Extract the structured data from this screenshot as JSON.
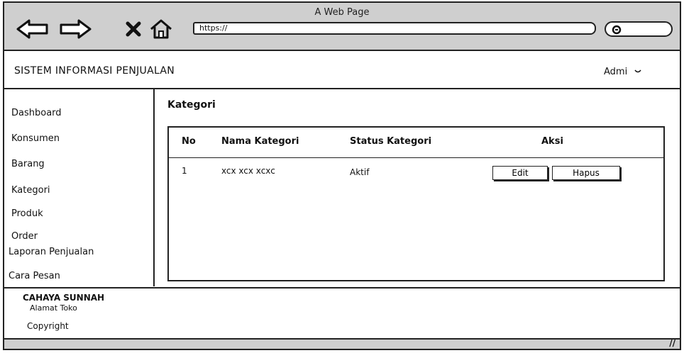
{
  "browser": {
    "window_title": "A Web Page",
    "url": "https://",
    "icons": [
      "back-arrow-icon",
      "forward-arrow-icon",
      "close-x-icon",
      "home-icon",
      "search-icon"
    ]
  },
  "header": {
    "app_title": "SISTEM INFORMASI PENJUALAN",
    "user_label": "Admi",
    "user_icon": "chevron-down-icon"
  },
  "sidebar": {
    "items": [
      {
        "label": "Dashboard"
      },
      {
        "label": "Konsumen"
      },
      {
        "label": "Barang"
      },
      {
        "label": "Kategori"
      },
      {
        "label": "Produk"
      },
      {
        "label": "Order"
      },
      {
        "label": "Laporan Penjualan"
      },
      {
        "label": "Cara Pesan"
      }
    ]
  },
  "main": {
    "page_title": "Kategori",
    "table": {
      "headers": [
        "No",
        "Nama Kategori",
        "Status Kategori",
        "Aksi"
      ],
      "rows": [
        {
          "no": "1",
          "nama": "xcx xcx xcxc",
          "status": "Aktif",
          "edit_label": "Edit",
          "hapus_label": "Hapus"
        }
      ]
    }
  },
  "footer": {
    "shop_name": "CAHAYA SUNNAH",
    "shop_address": "Alamat Toko",
    "copyright": "Copyright"
  }
}
